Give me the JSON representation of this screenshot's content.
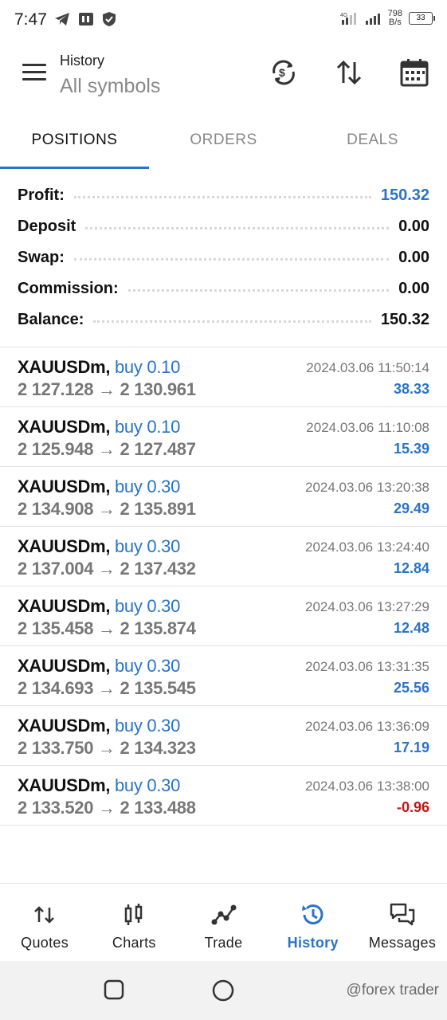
{
  "status_bar": {
    "time": "7:47",
    "net_speed_value": "798",
    "net_speed_unit": "B/s",
    "signal_label": "4G",
    "battery": "33"
  },
  "appbar": {
    "title": "History",
    "subtitle": "All symbols"
  },
  "tabs": [
    {
      "label": "POSITIONS",
      "active": true
    },
    {
      "label": "ORDERS",
      "active": false
    },
    {
      "label": "DEALS",
      "active": false
    }
  ],
  "summary": {
    "profit_label": "Profit:",
    "profit_value": "150.32",
    "deposit_label": "Deposit",
    "deposit_value": "0.00",
    "swap_label": "Swap:",
    "swap_value": "0.00",
    "commission_label": "Commission:",
    "commission_value": "0.00",
    "balance_label": "Balance:",
    "balance_value": "150.32"
  },
  "positions": [
    {
      "symbol": "XAUUSDm,",
      "type": "buy 0.10",
      "prices": "2 127.128 → 2 130.961",
      "time": "2024.03.06 11:50:14",
      "profit": "38.33",
      "negative": false
    },
    {
      "symbol": "XAUUSDm,",
      "type": "buy 0.10",
      "prices": "2 125.948 → 2 127.487",
      "time": "2024.03.06 11:10:08",
      "profit": "15.39",
      "negative": false
    },
    {
      "symbol": "XAUUSDm,",
      "type": "buy 0.30",
      "prices": "2 134.908 → 2 135.891",
      "time": "2024.03.06 13:20:38",
      "profit": "29.49",
      "negative": false
    },
    {
      "symbol": "XAUUSDm,",
      "type": "buy 0.30",
      "prices": "2 137.004 → 2 137.432",
      "time": "2024.03.06 13:24:40",
      "profit": "12.84",
      "negative": false
    },
    {
      "symbol": "XAUUSDm,",
      "type": "buy 0.30",
      "prices": "2 135.458 → 2 135.874",
      "time": "2024.03.06 13:27:29",
      "profit": "12.48",
      "negative": false
    },
    {
      "symbol": "XAUUSDm,",
      "type": "buy 0.30",
      "prices": "2 134.693 → 2 135.545",
      "time": "2024.03.06 13:31:35",
      "profit": "25.56",
      "negative": false
    },
    {
      "symbol": "XAUUSDm,",
      "type": "buy 0.30",
      "prices": "2 133.750 → 2 134.323",
      "time": "2024.03.06 13:36:09",
      "profit": "17.19",
      "negative": false
    },
    {
      "symbol": "XAUUSDm,",
      "type": "buy 0.30",
      "prices": "2 133.520 → 2 133.488",
      "time": "2024.03.06 13:38:00",
      "profit": "-0.96",
      "negative": true
    }
  ],
  "bottom_nav": [
    {
      "label": "Quotes",
      "icon": "quotes-icon",
      "active": false
    },
    {
      "label": "Charts",
      "icon": "charts-icon",
      "active": false
    },
    {
      "label": "Trade",
      "icon": "trade-icon",
      "active": false
    },
    {
      "label": "History",
      "icon": "history-icon",
      "active": true
    },
    {
      "label": "Messages",
      "icon": "messages-icon",
      "active": false
    }
  ],
  "watermark": "@forex trader",
  "colors": {
    "accent": "#2a74c8",
    "negative": "#c41515",
    "muted": "#777777"
  }
}
